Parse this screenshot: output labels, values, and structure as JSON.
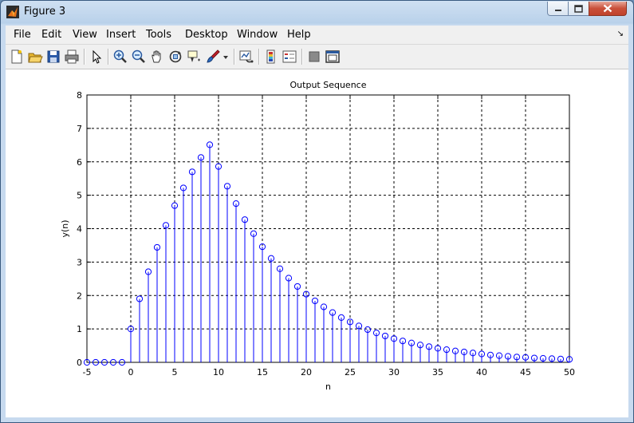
{
  "window": {
    "title": "Figure 3"
  },
  "menu": [
    "File",
    "Edit",
    "View",
    "Insert",
    "Tools",
    "Desktop",
    "Window",
    "Help"
  ],
  "toolbar": [
    "new-figure-icon",
    "open-file-icon",
    "save-icon",
    "print-icon",
    "select-arrow-icon",
    "zoom-in-icon",
    "zoom-out-icon",
    "pan-hand-icon",
    "rotate-3d-icon",
    "data-cursor-icon",
    "brush-icon",
    "brush-dropdown-icon",
    "link-plot-icon",
    "colorbar-icon",
    "legend-icon",
    "hide-plot-tools-icon",
    "show-plot-tools-icon"
  ],
  "colors": {
    "stem": "#0000ff",
    "grid": "#000000",
    "background": "#ffffff"
  },
  "chart_data": {
    "type": "stem",
    "title": "Output Sequence",
    "xlabel": "n",
    "ylabel": "y(n)",
    "xlim": [
      -5,
      50
    ],
    "ylim": [
      0,
      8
    ],
    "xticks": [
      -5,
      0,
      5,
      10,
      15,
      20,
      25,
      30,
      35,
      40,
      45,
      50
    ],
    "yticks": [
      0,
      1,
      2,
      3,
      4,
      5,
      6,
      7,
      8
    ],
    "grid": true,
    "marker": "circle",
    "x": [
      -5,
      -4,
      -3,
      -2,
      -1,
      0,
      1,
      2,
      3,
      4,
      5,
      6,
      7,
      8,
      9,
      10,
      11,
      12,
      13,
      14,
      15,
      16,
      17,
      18,
      19,
      20,
      21,
      22,
      23,
      24,
      25,
      26,
      27,
      28,
      29,
      30,
      31,
      32,
      33,
      34,
      35,
      36,
      37,
      38,
      39,
      40,
      41,
      42,
      43,
      44,
      45,
      46,
      47,
      48,
      49,
      50
    ],
    "y": [
      0,
      0,
      0,
      0,
      0,
      1,
      1.9,
      2.71,
      3.44,
      4.1,
      4.69,
      5.22,
      5.7,
      6.13,
      6.51,
      5.86,
      5.27,
      4.75,
      4.27,
      3.85,
      3.46,
      3.11,
      2.8,
      2.52,
      2.27,
      2.04,
      1.84,
      1.66,
      1.49,
      1.34,
      1.21,
      1.09,
      0.98,
      0.88,
      0.79,
      0.71,
      0.64,
      0.58,
      0.52,
      0.47,
      0.42,
      0.38,
      0.34,
      0.31,
      0.28,
      0.25,
      0.22,
      0.2,
      0.18,
      0.16,
      0.15,
      0.13,
      0.12,
      0.11,
      0.1,
      0.09
    ]
  }
}
